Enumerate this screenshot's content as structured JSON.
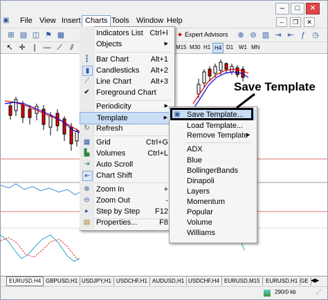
{
  "menubar": {
    "items": [
      "File",
      "View",
      "Insert",
      "Charts",
      "Tools",
      "Window",
      "Help"
    ]
  },
  "toolbar": {
    "expert_advisors": "Expert Advisors",
    "timeframes": [
      "M15",
      "M30",
      "H1",
      "H4",
      "D1",
      "W1",
      "MN"
    ],
    "active_timeframe": "H4"
  },
  "charts_menu": {
    "items": [
      {
        "label": "Indicators List",
        "accel": "Ctrl+I",
        "icon": "none"
      },
      {
        "label": "Objects",
        "accel": "",
        "submenu": true,
        "icon": "none"
      },
      {
        "label": "Bar Chart",
        "accel": "Alt+1",
        "icon": "bar-chart-icon"
      },
      {
        "label": "Candlesticks",
        "accel": "Alt+2",
        "icon": "candlestick-icon"
      },
      {
        "label": "Line Chart",
        "accel": "Alt+3",
        "icon": "line-chart-icon"
      },
      {
        "label": "Foreground Chart",
        "accel": "",
        "icon": "check-icon"
      },
      {
        "label": "Periodicity",
        "accel": "",
        "submenu": true,
        "icon": "none"
      },
      {
        "label": "Template",
        "accel": "",
        "submenu": true,
        "icon": "none",
        "highlighted": true
      },
      {
        "label": "Refresh",
        "accel": "",
        "icon": "refresh-icon"
      },
      {
        "label": "Grid",
        "accel": "Ctrl+G",
        "icon": "grid-icon"
      },
      {
        "label": "Volumes",
        "accel": "Ctrl+L",
        "icon": "volumes-icon"
      },
      {
        "label": "Auto Scroll",
        "accel": "",
        "icon": "auto-scroll-icon"
      },
      {
        "label": "Chart Shift",
        "accel": "",
        "icon": "chart-shift-icon"
      },
      {
        "label": "Zoom In",
        "accel": "+",
        "icon": "zoom-in-icon"
      },
      {
        "label": "Zoom Out",
        "accel": "-",
        "icon": "zoom-out-icon"
      },
      {
        "label": "Step by Step",
        "accel": "F12",
        "icon": "step-icon"
      },
      {
        "label": "Properties...",
        "accel": "F8",
        "icon": "properties-icon"
      }
    ]
  },
  "template_menu": {
    "save": "Save Template...",
    "load": "Load Template...",
    "remove": "Remove Template",
    "templates": [
      "ADX",
      "Blue",
      "BollingerBands",
      "Dinapoli",
      "Layers",
      "Momentum",
      "Popular",
      "Volume",
      "Williams"
    ]
  },
  "callout": "Save Template",
  "tabs": [
    "EURUSD,H4",
    "GBPUSD,H1",
    "USDJPY,H1",
    "USDCHF,H1",
    "AUDUSD,H1",
    "USDCHF,H4",
    "EURUSD,M15",
    "EURUSD,H1",
    "GE"
  ],
  "active_tab": "EURUSD,H4",
  "status": {
    "traffic": "290/0 kb"
  },
  "colors": {
    "menu_highlight": "#c9ddf5",
    "accent": "#2b5aa0",
    "ma_red": "#e00000",
    "ma_blue": "#0000e0"
  }
}
